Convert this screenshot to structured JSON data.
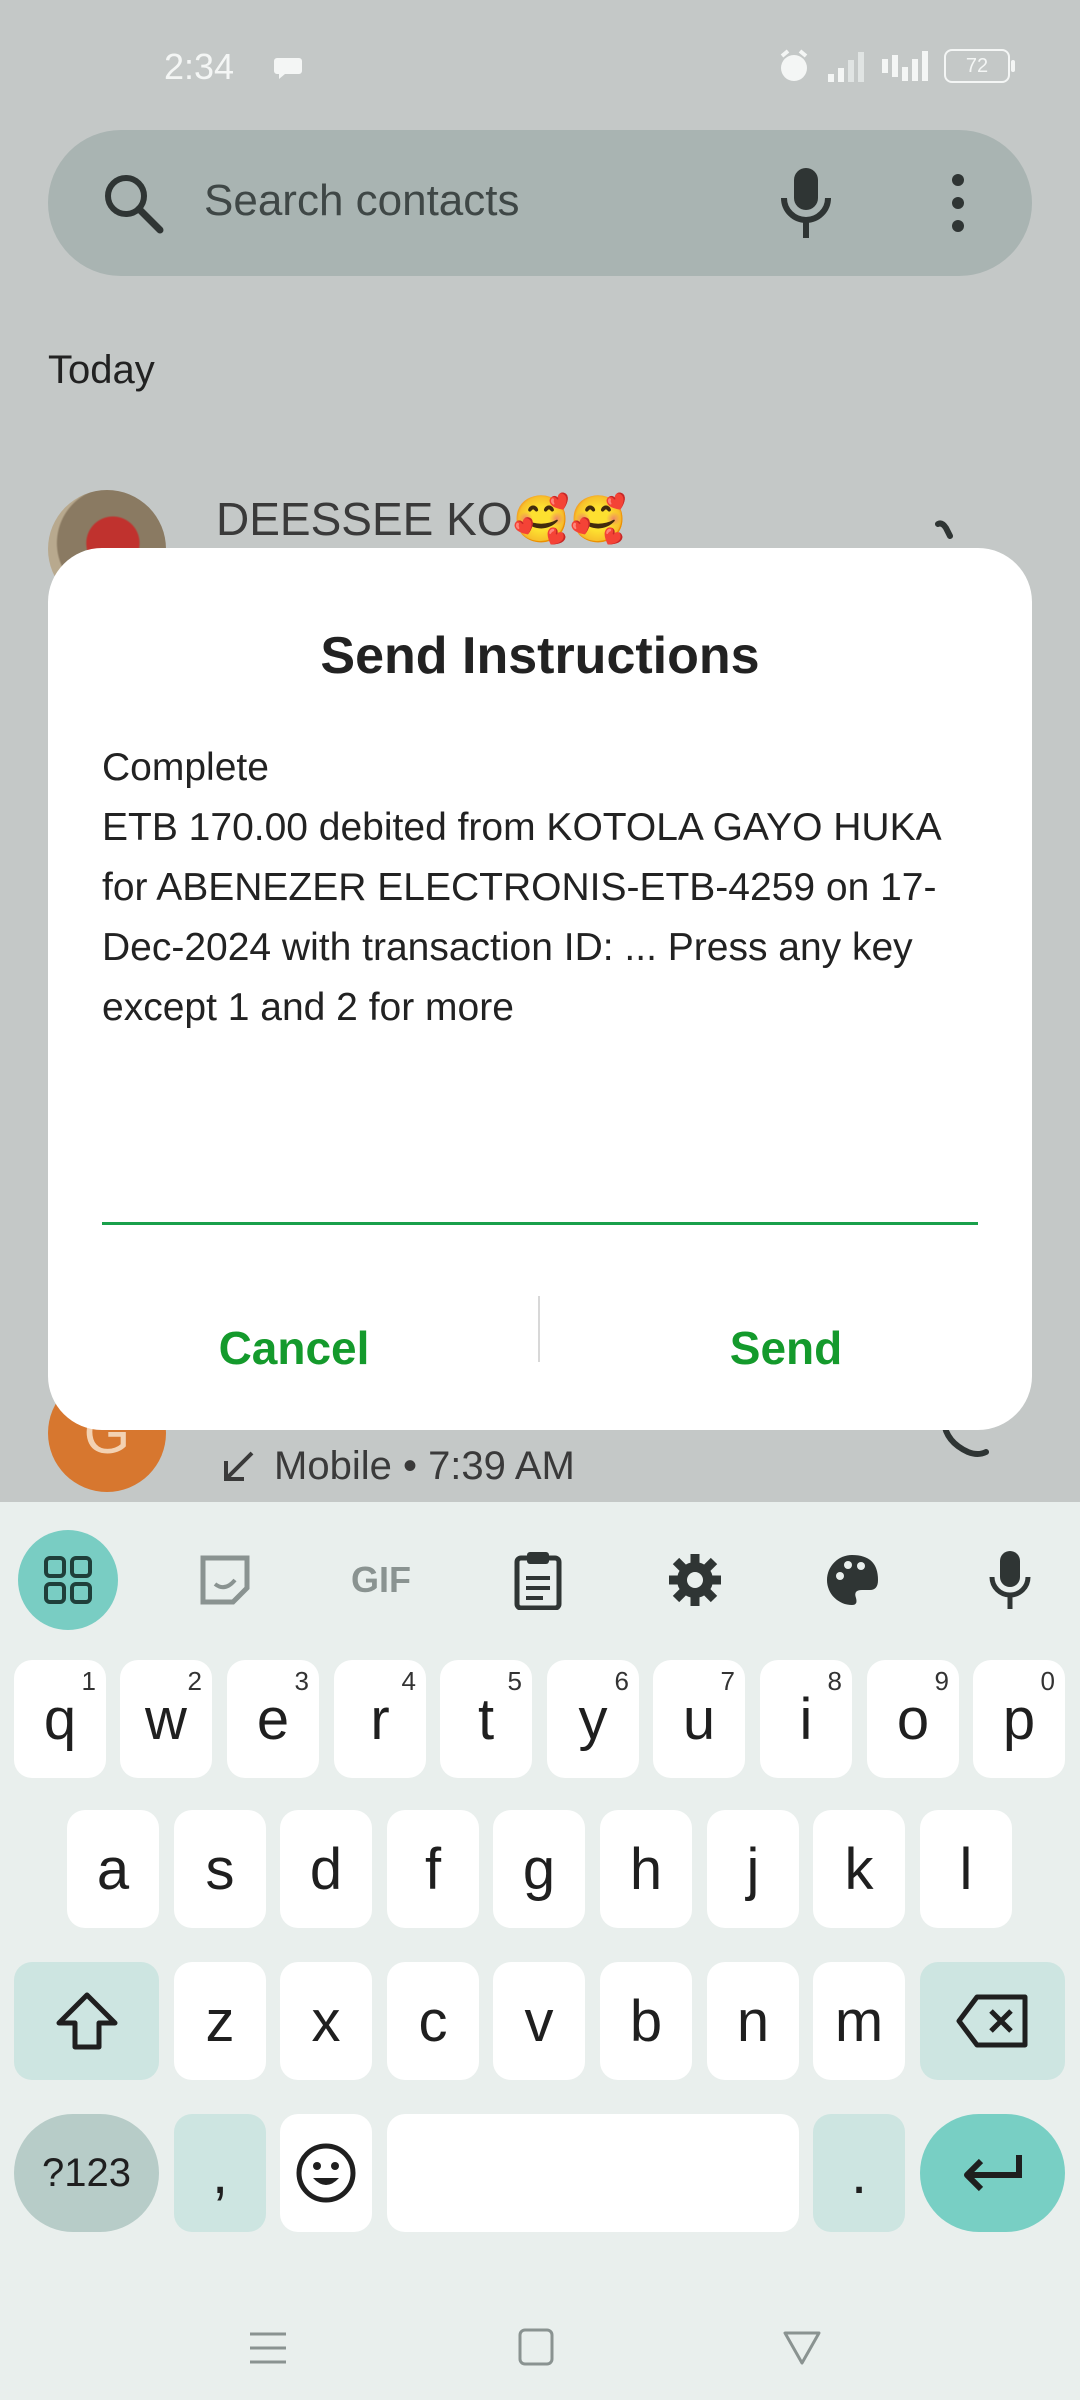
{
  "status_bar": {
    "time": "2:34",
    "battery": "72"
  },
  "search": {
    "placeholder": "Search contacts"
  },
  "section_label": "Today",
  "contacts": [
    {
      "name": "DEESSEE KO🥰🥰"
    },
    {
      "initial": "G",
      "detail": "Mobile • 7:39 AM"
    }
  ],
  "dialog": {
    "title": "Send Instructions",
    "body_line1": "Complete",
    "body_rest": "ETB 170.00 debited from KOTOLA GAYO HUKA for ABENEZER ELECTRONIS-ETB-4259 on 17-Dec-2024 with transaction ID: ... Press any key except 1 and 2 for more",
    "input_value": "",
    "cancel_label": "Cancel",
    "send_label": "Send"
  },
  "keyboard": {
    "toolbar": [
      "apps-icon",
      "sticker-icon",
      "GIF",
      "clipboard-icon",
      "gear-icon",
      "palette-icon",
      "mic-icon"
    ],
    "row1": [
      {
        "k": "q",
        "h": "1"
      },
      {
        "k": "w",
        "h": "2"
      },
      {
        "k": "e",
        "h": "3"
      },
      {
        "k": "r",
        "h": "4"
      },
      {
        "k": "t",
        "h": "5"
      },
      {
        "k": "y",
        "h": "6"
      },
      {
        "k": "u",
        "h": "7"
      },
      {
        "k": "i",
        "h": "8"
      },
      {
        "k": "o",
        "h": "9"
      },
      {
        "k": "p",
        "h": "0"
      }
    ],
    "row2": [
      "a",
      "s",
      "d",
      "f",
      "g",
      "h",
      "j",
      "k",
      "l"
    ],
    "row3": [
      "z",
      "x",
      "c",
      "v",
      "b",
      "n",
      "m"
    ],
    "symbols_label": "?123",
    "comma": ",",
    "period": "."
  },
  "colors": {
    "accent_green": "#149a2c",
    "keyboard_accent": "#78cfc4"
  }
}
